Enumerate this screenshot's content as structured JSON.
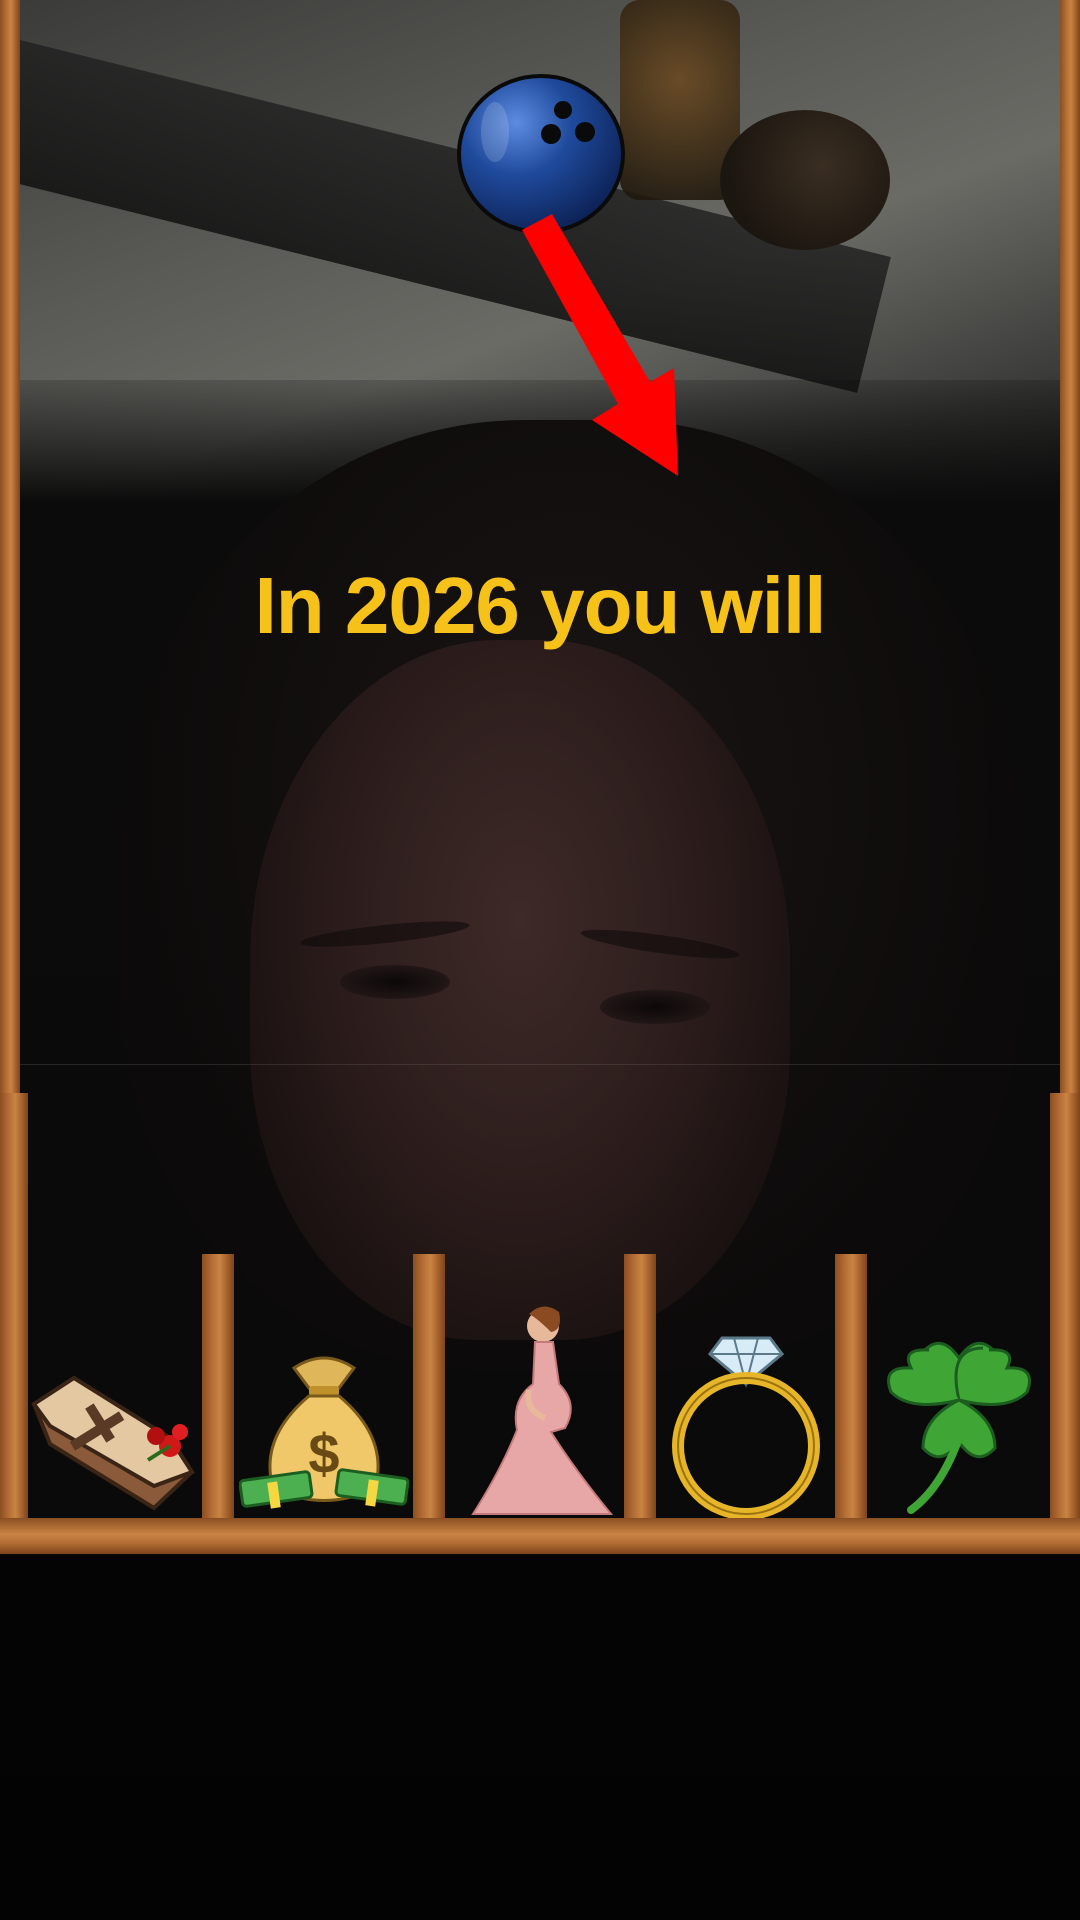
{
  "headline": "In 2026 you will",
  "game": {
    "ball_icon": "bowling-ball-icon",
    "pointer_icon": "red-arrow-icon",
    "colors": {
      "headline": "#f6c21a",
      "wood": "#b36c34",
      "ball": "#1f3f8c",
      "arrow": "#ff0000"
    },
    "slots": [
      {
        "icon": "coffin-icon"
      },
      {
        "icon": "money-bag-icon"
      },
      {
        "icon": "pregnant-woman-icon"
      },
      {
        "icon": "diamond-ring-icon"
      },
      {
        "icon": "four-leaf-clover-icon"
      }
    ]
  }
}
